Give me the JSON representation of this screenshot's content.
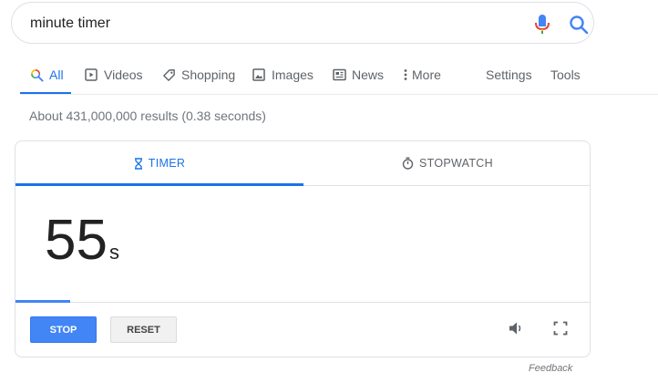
{
  "search": {
    "query": "minute timer"
  },
  "nav": {
    "tabs": [
      {
        "label": "All",
        "icon": "search-icon",
        "active": true
      },
      {
        "label": "Videos",
        "icon": "video-icon"
      },
      {
        "label": "Shopping",
        "icon": "tag-icon"
      },
      {
        "label": "Images",
        "icon": "image-icon"
      },
      {
        "label": "News",
        "icon": "news-icon"
      },
      {
        "label": "More",
        "icon": "more-vertical-icon"
      }
    ],
    "settings_label": "Settings",
    "tools_label": "Tools"
  },
  "results": {
    "stats": "About 431,000,000 results (0.38 seconds)"
  },
  "timer": {
    "tabs": [
      {
        "label": "TIMER",
        "icon": "hourglass-icon",
        "active": true
      },
      {
        "label": "STOPWATCH",
        "icon": "stopwatch-icon"
      }
    ],
    "value": "55",
    "unit": "s",
    "progress_fraction": 0.095,
    "stop_label": "STOP",
    "reset_label": "RESET",
    "volume_icon": "volume-icon",
    "fullscreen_icon": "fullscreen-icon"
  },
  "feedback_label": "Feedback",
  "colors": {
    "accent": "#1a73e8",
    "progress": "#4285f4",
    "stop_button": "#4285f4"
  }
}
